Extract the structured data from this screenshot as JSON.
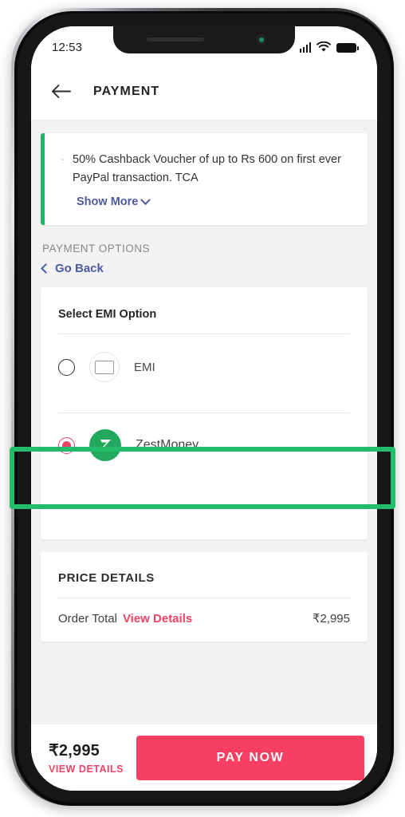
{
  "status_bar": {
    "time": "12:53",
    "signal_icon": "signal-bars-icon",
    "wifi_icon": "wifi-icon",
    "battery_icon": "battery-full-icon"
  },
  "app_bar": {
    "back_icon": "back-arrow-icon",
    "title": "PAYMENT"
  },
  "offer": {
    "bullet": "·",
    "text": "50% Cashback Voucher of up to Rs 600 on first ever PayPal transaction. TCA",
    "show_more_label": "Show More",
    "chevron_icon": "chevron-down-icon",
    "accent_color": "#27b16a"
  },
  "payment_options": {
    "section_label": "PAYMENT OPTIONS",
    "go_back_label": "Go Back",
    "go_back_icon": "chevron-left-icon",
    "link_color": "#4c5ba0",
    "card_title": "Select EMI Option",
    "rows": [
      {
        "label": "EMI",
        "icon": "credit-card-icon",
        "selected": false
      },
      {
        "label": "ZestMoney",
        "icon": "zestmoney-logo-icon",
        "selected": true
      }
    ]
  },
  "price_details": {
    "title": "PRICE DETAILS",
    "row_label": "Order Total",
    "view_details_label": "View Details",
    "amount": "₹2,995"
  },
  "bottom_bar": {
    "amount": "₹2,995",
    "view_details_label": "VIEW DETAILS",
    "pay_label": "PAY NOW",
    "pay_color": "#f93e63"
  },
  "annotation": {
    "target": "ZestMoney",
    "color": "#22bc6b"
  }
}
